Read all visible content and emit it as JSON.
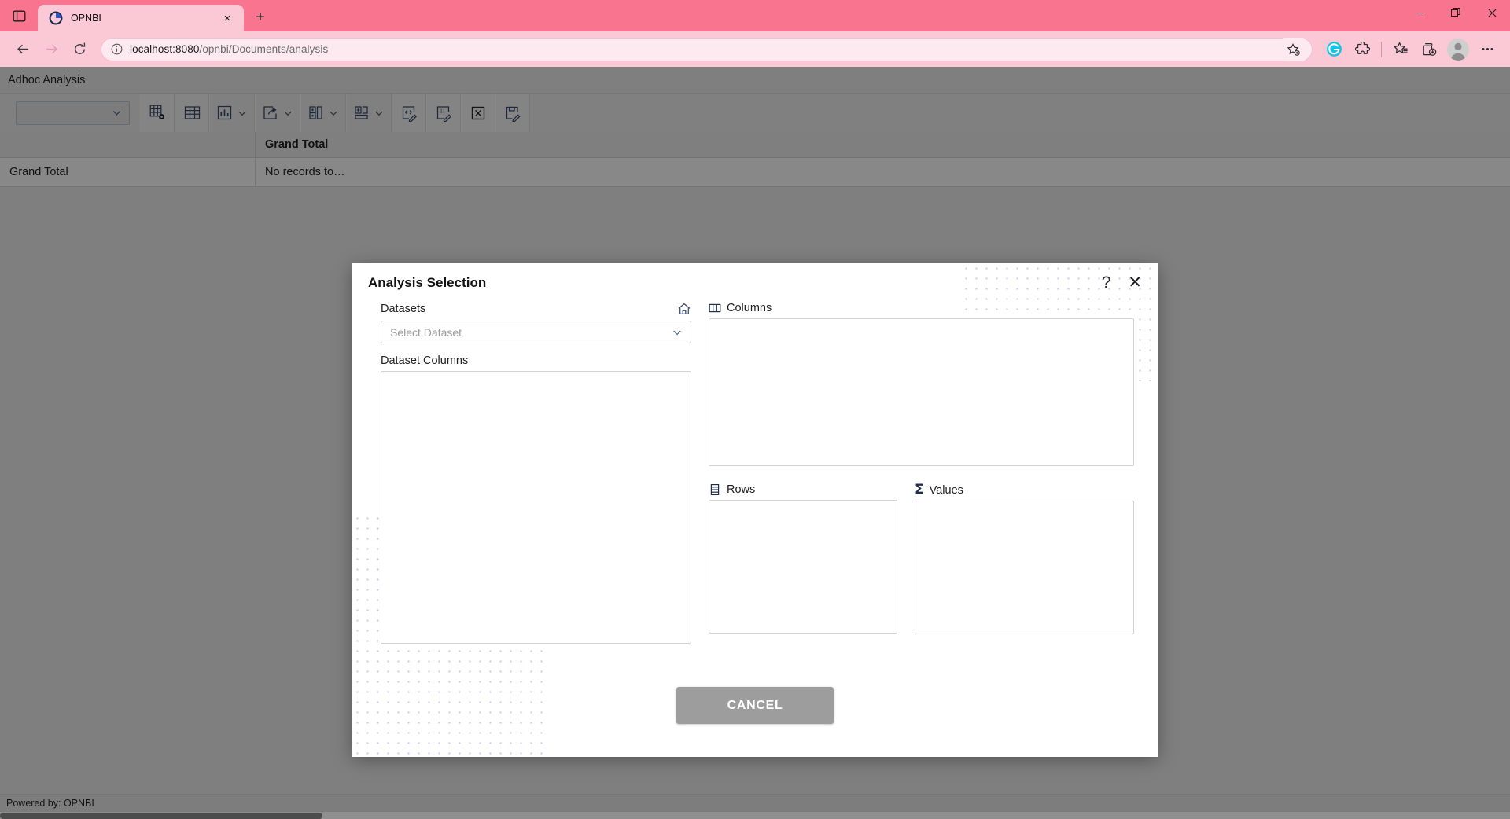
{
  "browser": {
    "tab": {
      "title": "OPNBI",
      "favicon": "opnbi-logo-icon",
      "close_label": "×"
    },
    "new_tab_label": "+",
    "tab_search_icon": "tab-search-icon",
    "window_controls": {
      "minimize": "—",
      "maximize": "❐",
      "close": "✕"
    },
    "nav": {
      "back": "←",
      "forward": "→",
      "reload": "⟳"
    },
    "omnibox": {
      "info_icon": "info-icon",
      "url_host": "localhost:8080",
      "url_path": "/opnbi/Documents/analysis",
      "favorite_icon": "add-favorite-icon"
    },
    "toolbar_icons": [
      "grammarly-icon",
      "extensions-icon",
      "favorites-icon",
      "collections-icon",
      "profile-avatar-icon",
      "settings-more-icon"
    ]
  },
  "app": {
    "title": "Adhoc Analysis",
    "toolbar": {
      "dataset_select_value": "",
      "buttons": [
        {
          "name": "table-settings-icon",
          "caret": false
        },
        {
          "name": "pivot-table-icon",
          "caret": false
        },
        {
          "name": "chart-icon",
          "caret": true
        },
        {
          "name": "export-share-icon",
          "caret": true
        },
        {
          "name": "add-column-icon",
          "caret": true
        },
        {
          "name": "add-layout-icon",
          "caret": true
        },
        {
          "name": "code-edit-icon",
          "caret": false
        },
        {
          "name": "note-edit-icon",
          "caret": false
        },
        {
          "name": "excel-export-icon",
          "caret": false
        },
        {
          "name": "save-edit-icon",
          "caret": false
        }
      ]
    },
    "grid": {
      "header": [
        "",
        "Grand Total"
      ],
      "rows": [
        [
          "Grand Total",
          "No records to…"
        ]
      ]
    },
    "footer": "Powered by: OPNBI"
  },
  "modal": {
    "title": "Analysis Selection",
    "help_label": "?",
    "close_label": "✕",
    "datasets": {
      "label": "Datasets",
      "home_icon": "home-icon",
      "select_placeholder": "Select Dataset",
      "select_value": ""
    },
    "dataset_columns": {
      "label": "Dataset Columns",
      "items": []
    },
    "columns_zone": {
      "label": "Columns",
      "icon": "columns-icon",
      "items": []
    },
    "rows_zone": {
      "label": "Rows",
      "icon": "rows-icon",
      "items": []
    },
    "values_zone": {
      "label": "Values",
      "icon": "sigma-icon",
      "items": []
    },
    "cancel_label": "CANCEL"
  },
  "colors": {
    "browser_accent": "#f9758f",
    "tab_bg": "#fbc8d5",
    "app_bg": "#b6b6b6",
    "modal_bg": "#ffffff",
    "cancel_button": "#9d9d9d",
    "dot_pattern": "#9aa3d8"
  }
}
